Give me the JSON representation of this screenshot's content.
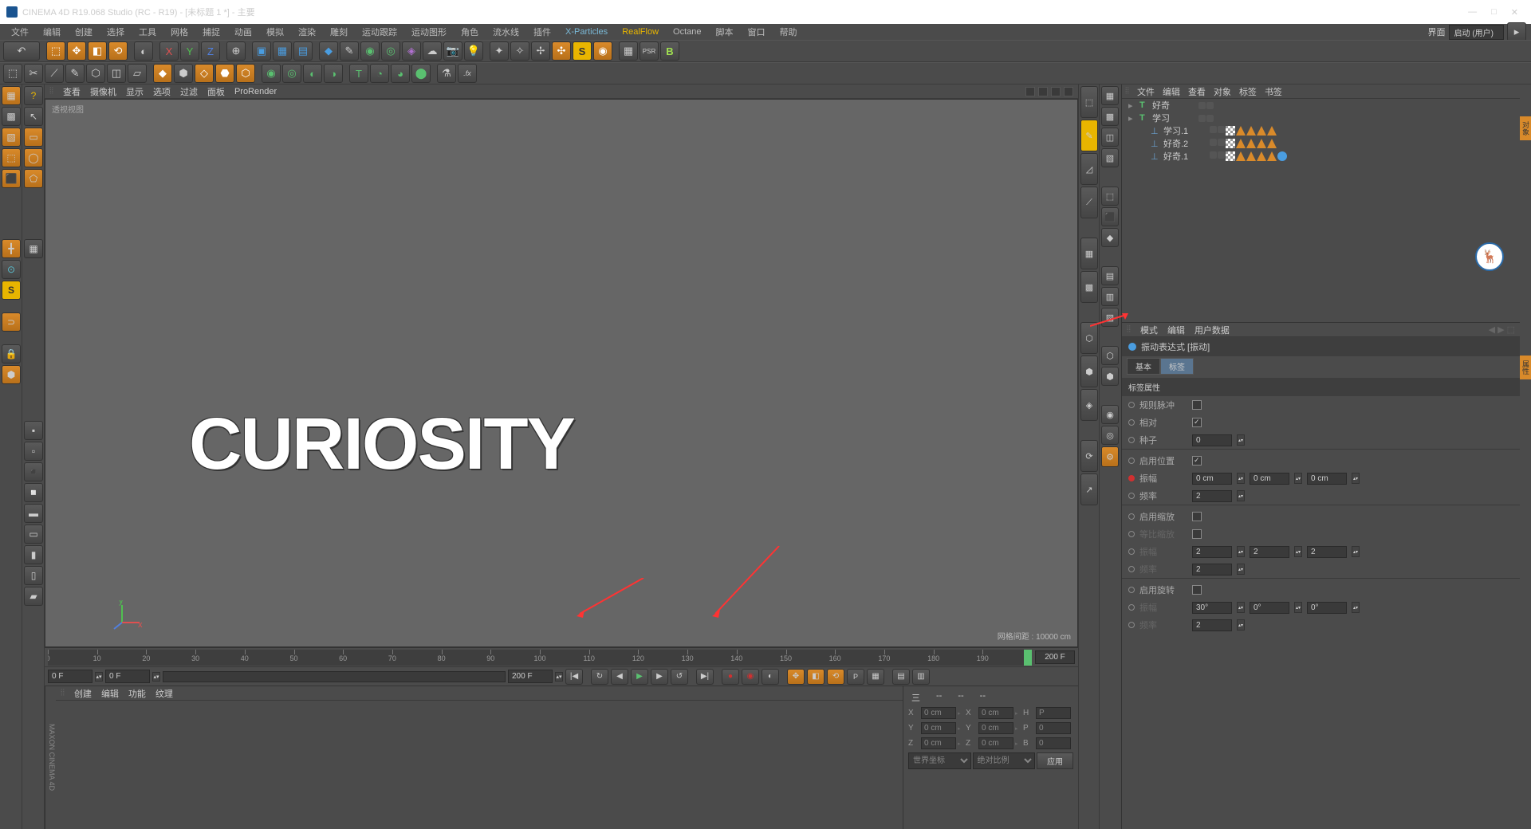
{
  "title": "CINEMA 4D R19.068 Studio (RC - R19) - [未标题 1 *] - 主要",
  "menu": [
    "文件",
    "编辑",
    "创建",
    "选择",
    "工具",
    "网格",
    "捕捉",
    "动画",
    "模拟",
    "渲染",
    "雕刻",
    "运动跟踪",
    "运动图形",
    "角色",
    "流水线",
    "插件",
    "X-Particles",
    "RealFlow",
    "Octane",
    "脚本",
    "窗口",
    "帮助"
  ],
  "layout_label": "界面",
  "layout_value": "启动 (用户)",
  "vp_menu": [
    "查看",
    "摄像机",
    "显示",
    "选项",
    "过滤",
    "面板",
    "ProRender"
  ],
  "vp_name": "透视视图",
  "vp_text": "CURIOSITY",
  "grid_info": "网格间距 : 10000 cm",
  "obj_tabs": [
    "文件",
    "编辑",
    "查看",
    "对象",
    "标签",
    "书签"
  ],
  "tree": [
    {
      "icon": "T",
      "name": "好奇",
      "lvl": 0,
      "tags": [
        "g",
        "g"
      ]
    },
    {
      "icon": "T",
      "name": "学习",
      "lvl": 0,
      "tags": [
        "g",
        "g"
      ]
    },
    {
      "icon": "N",
      "name": "学习.1",
      "lvl": 1,
      "tags": [
        "g",
        "g",
        "chk",
        "tri",
        "tri",
        "tri",
        "tri"
      ]
    },
    {
      "icon": "N",
      "name": "好奇.2",
      "lvl": 1,
      "tags": [
        "g",
        "g",
        "chk",
        "tri",
        "tri",
        "tri",
        "tri"
      ]
    },
    {
      "icon": "N",
      "name": "好奇.1",
      "lvl": 1,
      "tags": [
        "g",
        "g",
        "chk",
        "tri",
        "tri",
        "tri",
        "tri",
        "target"
      ]
    }
  ],
  "attr_tabs": [
    "模式",
    "编辑",
    "用户数据"
  ],
  "attr_title": "振动表达式 [振动]",
  "attr_subtabs": [
    "基本",
    "标签"
  ],
  "attr_section": "标签属性",
  "rows": {
    "r1": "规则脉冲",
    "r2": "相对",
    "r3": "种子",
    "r3v": "0",
    "r4": "启用位置",
    "r5": "振幅",
    "r5v": "0 cm",
    "r6": "频率",
    "r6v": "2",
    "r7": "启用缩放",
    "r8": "等比缩放",
    "r9": "振幅",
    "r9v": "2",
    "r10": "频率",
    "r10v": "2",
    "r11": "启用旋转",
    "r12": "振幅",
    "r12v": "30°",
    "r12v2": "0°",
    "r12v3": "0°",
    "r13": "频率",
    "r13v": "2"
  },
  "timeline": {
    "start": "0 F",
    "cur": "0 F",
    "end": "200 F",
    "end2": "200 F"
  },
  "mat_tabs": [
    "创建",
    "编辑",
    "功能",
    "纹理"
  ],
  "coord": {
    "hdr": [
      "三",
      "--",
      "--",
      "--"
    ],
    "x": "0 cm",
    "y": "0 cm",
    "z": "0 cm",
    "sx": "0 cm",
    "sy": "0 cm",
    "sz": "0 cm",
    "h": "P",
    "p": "0",
    "b": "0",
    "sel1": "世界坐标",
    "sel2": "绝对比例",
    "btn": "应用"
  }
}
